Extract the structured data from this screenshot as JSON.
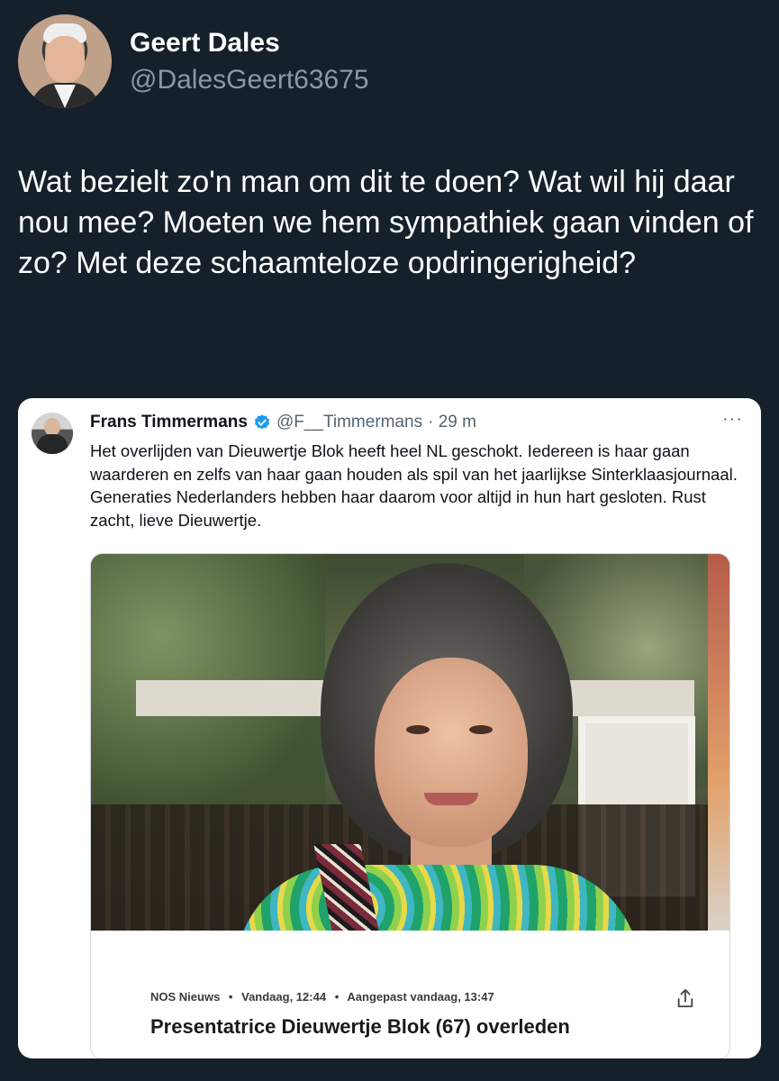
{
  "author": {
    "display_name": "Geert Dales",
    "handle": "@DalesGeert63675",
    "avatar_icon": "profile-photo"
  },
  "tweet": {
    "text": "Wat bezielt zo'n man om dit te doen? Wat wil hij daar nou mee? Moeten we hem sympathiek gaan vinden of zo? Met deze schaamteloze opdringerigheid?"
  },
  "quoted": {
    "name": "Frans Timmermans",
    "handle": "@F__Timmermans",
    "time": "· 29 m",
    "more_label": "···",
    "text": "Het overlijden van Dieuwertje Blok heeft heel NL geschokt. Iedereen is haar gaan waarderen en zelfs van haar gaan houden als spil van het jaarlijkse Sinterklaasjournaal. Generaties Nederlanders hebben haar daarom voor altijd in hun hart gesloten. Rust zacht, lieve Dieuwertje.",
    "verified_color": "#1d9bf0",
    "media": {
      "source": "NOS Nieuws",
      "date": "Vandaag, 12:44",
      "updated": "Aangepast vandaag, 13:47",
      "separator": "•",
      "headline": "Presentatrice Dieuwertje Blok (67) overleden",
      "share_icon": "share-icon"
    }
  }
}
